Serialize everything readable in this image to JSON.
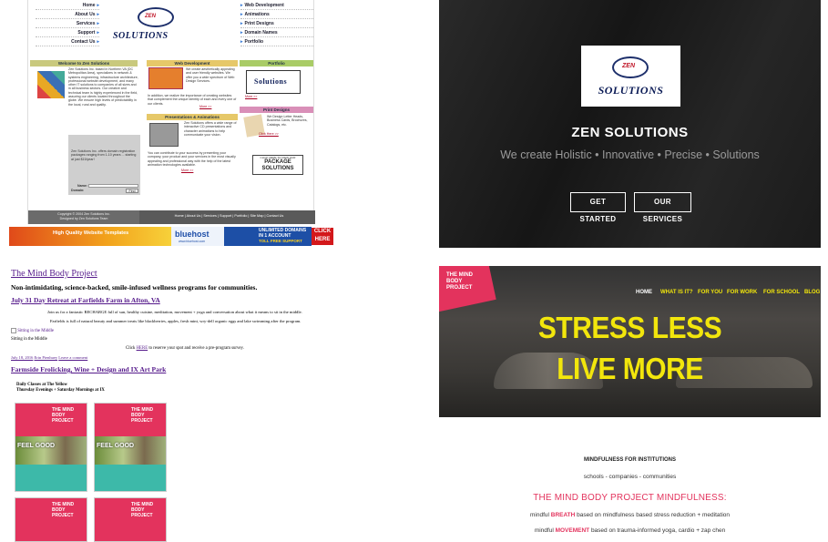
{
  "old_site": {
    "nav_left": [
      "Home",
      "About Us",
      "Services",
      "Support",
      "Contact Us"
    ],
    "nav_right": [
      "Web Development",
      "Animations",
      "Print Designs",
      "Domain Names",
      "Portfolio"
    ],
    "logo_text": "SOLUTIONS",
    "logo_zen": "ZEN",
    "welcome_title": "Welcome to Zen Solutions",
    "welcome_text": "Zen Solutions Inc. based in Northern VA (DC Metropolitan Area), specializes in network & systems engineering, infrastructure architecture, professional website development, and many other IT solutions to companies of all sizes and in all business sectors. Our creative and technical team is highly experienced in the field, assuring our clients located throughout the globe. We ensure high levels of predictability in the local, rural and quality.",
    "webdev_title": "Web Development",
    "webdev_text": "We create aesthetically appealing and user friendly websites. We offer you a wide spectrum of Web Design Services.",
    "webdev_text2": "In addition, we realize the importance of creating websites that complement the unique identity of each and every one of our clients.",
    "more": "More >>",
    "portfolio_title": "Portfolio",
    "portfolio_logo": "Solutions",
    "presentations_title": "Presentations & Animations",
    "presentations_text": "Zen Solutions offers a wide range of interactive CD presentations and character animations to help communicate your vision.",
    "presentations_text2": "You can contribute to your success by presenting your company, your product and your services in the most visually appealing and professional way with the help of the latest animation technologies available.",
    "print_title": "Print Designs",
    "print_text": "We Design Letter Heads, Business Cards, Brochures, Catalogs, etc.",
    "click_here": "Click Here >>",
    "domain_text": "Zen Solutions Inc. offers domain registration packages ranging from 1-10 years ... starting at just $15/year!",
    "name_label": "Name:",
    "domain_label": "Domain:",
    "find_button": "Find",
    "package_line1": "CLICK HERE TO VIEW OUR",
    "package_line2": "PACKAGE",
    "package_line3": "SOLUTIONS",
    "copyright_line1": "Copyright © 2004 Zen Solutions Inc.",
    "copyright_line2": "Designed by Zen Solutions Team",
    "footer_links": "Home | About Us | Services | Support | Portfolio | Site Map | Contact Us",
    "banner_left": "High Quality Website Templates",
    "banner_mid": "bluehost",
    "banner_mid_sub": "www.bluehost.com",
    "banner_right1": "UNLIMITED DOMAINS",
    "banner_right2": "IN 1 ACCOUNT",
    "banner_right3": "TOLL FREE SUPPORT",
    "banner_click": "CLICK HERE"
  },
  "dark_site": {
    "logo_zen": "ZEN",
    "logo_text": "SOLUTIONS",
    "title": "ZEN SOLUTIONS",
    "tagline": "We create Holistic • Innovative • Precise • Solutions",
    "btn_start": "GET STARTED",
    "btn_services": "OUR SERVICES"
  },
  "blog": {
    "site_title": "The Mind Body Project",
    "tagline": "Non-intimidating, science-backed, smile-infused wellness programs for communities.",
    "post1_title": "July 31 Day Retreat at Farfields Farm in Afton, VA",
    "post1_p1": "Join us for a fantastic RECHARGE full of sun, healthy cuisine, meditation, movement + yoga and conversation about what it means to sit in the middle.",
    "post1_p2": "Farfields is full of natural beauty and summer treats like blackberries, apples, fresh mint, wry-dell organic eggs and lake swimming after the program.",
    "img_alt": "Sitting in the Middle",
    "caption": "Sitting in the Middle",
    "click_pre": "Click ",
    "click_link": "HERE",
    "click_post": " to reserve your spot and receive a pre-program survey.",
    "meta_date": "July 18, 2016",
    "meta_author": "Erin Pienhuey",
    "meta_comment": "Leave a comment",
    "post2_title": "Farmside Frolicking, Wine + Design and IX Art Park",
    "classes_line1": "Daily Classes at The Yellow",
    "classes_line2": "Thursday Evenings + Saturday Mornings at IX",
    "poster_brand": "THE MIND BODY PROJECT",
    "poster_feel": "FEEL GOOD"
  },
  "mbp_site": {
    "logo": "THE MIND BODY PROJECT",
    "nav": [
      "HOME",
      "WHAT IS IT?",
      "FOR YOU",
      "FOR WORK",
      "FOR SCHOOL",
      "BLOG"
    ],
    "headline1": "STRESS LESS",
    "headline2": "LIVE MORE",
    "section_title": "MINDFULNESS FOR INSTITUTIONS",
    "section_sub": "schools - companies - communities",
    "heading": "THE MIND BODY PROJECT MINDFULNESS:",
    "line1_pre": "mindful ",
    "line1_bold": "BREATH",
    "line1_post": " based on mindfulness based stress reduction + meditation",
    "line2_pre": "mindful ",
    "line2_bold": "MOVEMENT",
    "line2_post": " based on trauma-informed yoga, cardio + zap chen"
  },
  "colors": {
    "zen_navy": "#1d2f6b",
    "mbp_yellow": "#f2e60c",
    "mbp_pink": "#e3335d",
    "mbp_teal": "#3db9a9",
    "link_purple": "#551a8b"
  }
}
